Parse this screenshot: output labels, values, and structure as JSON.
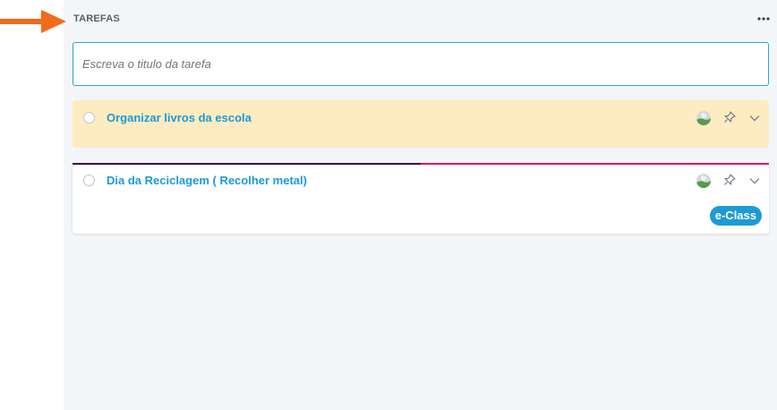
{
  "header": {
    "title": "TAREFAS",
    "more_icon": "more-dots-icon"
  },
  "new_task": {
    "placeholder": "Escreva o titulo da tarefa",
    "value": ""
  },
  "tasks": [
    {
      "title": "Organizar livros da escola",
      "background": "#fdecc1",
      "icons": [
        "avatar",
        "pin-icon",
        "chevron-down-icon"
      ]
    },
    {
      "title": "Dia da Reciclagem ( Recolher metal)",
      "background": "#ffffff",
      "top_line_colors": [
        "#3a0c4a",
        "#d81b6a"
      ],
      "badge": "e-Class",
      "icons": [
        "avatar",
        "pin-icon",
        "chevron-down-icon"
      ]
    }
  ],
  "colors": {
    "accent": "#1e9ad6",
    "arrow": "#f26a1b",
    "panel_bg": "#f3f6f8"
  }
}
